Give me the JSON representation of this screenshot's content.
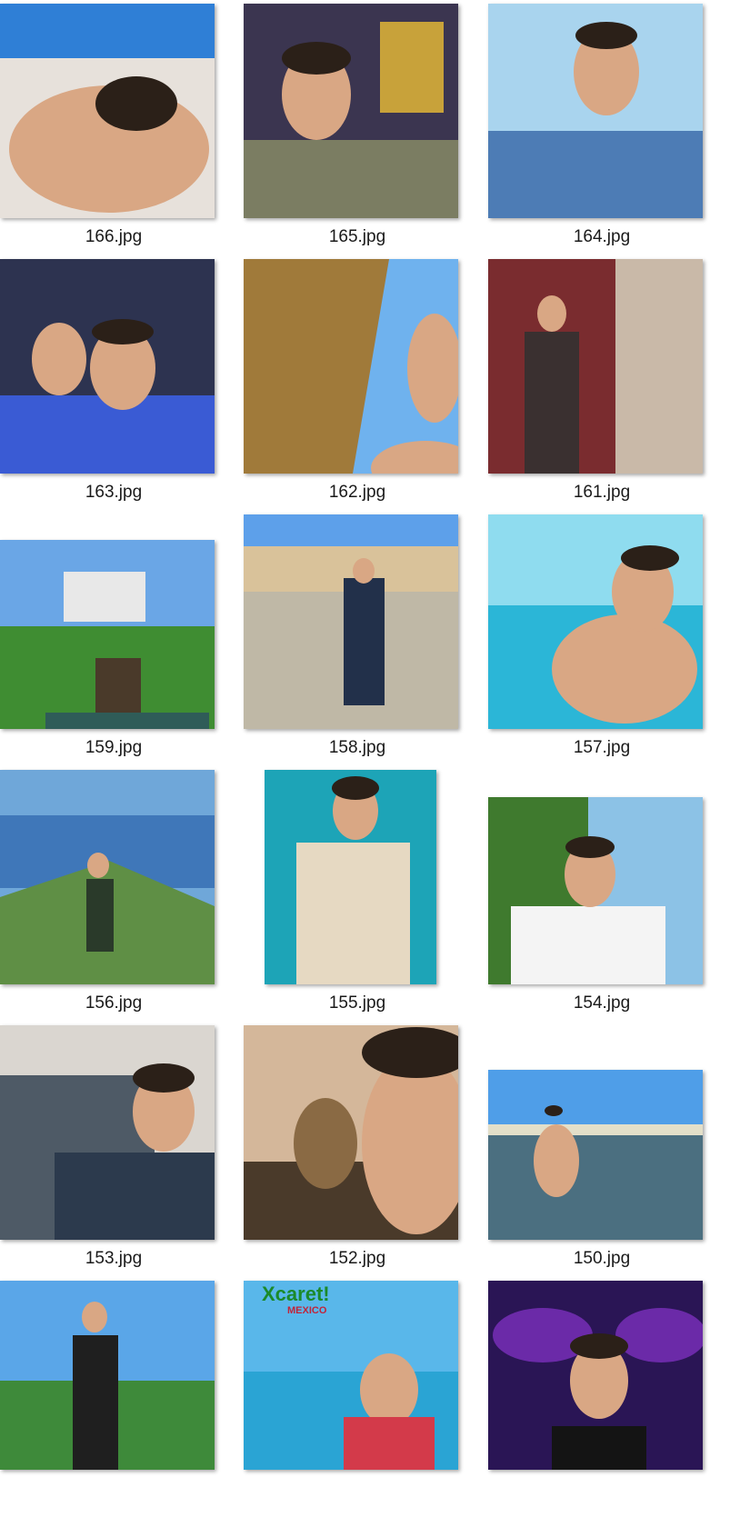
{
  "files": [
    {
      "name": "166.jpg",
      "icon": "photo-thumbnail",
      "sky": "#2f7fd6",
      "ground": "#e7e1db"
    },
    {
      "name": "165.jpg",
      "icon": "photo-thumbnail",
      "sky": "#3b3550",
      "ground": "#7b7d62"
    },
    {
      "name": "164.jpg",
      "icon": "photo-thumbnail",
      "sky": "#a9d4ee",
      "ground": "#4d7cb5"
    },
    {
      "name": "163.jpg",
      "icon": "photo-thumbnail",
      "sky": "#2d3350",
      "ground": "#3a5bd4"
    },
    {
      "name": "162.jpg",
      "icon": "photo-thumbnail",
      "sky": "#6fb2ee",
      "ground": "#a07a3a"
    },
    {
      "name": "161.jpg",
      "icon": "photo-thumbnail",
      "sky": "#7a2c2f",
      "ground": "#c9b9a8"
    },
    {
      "name": "159.jpg",
      "icon": "photo-thumbnail",
      "sky": "#6aa6e6",
      "ground": "#3f8d32"
    },
    {
      "name": "158.jpg",
      "icon": "photo-thumbnail",
      "sky": "#5da0ea",
      "ground": "#bfb8a6"
    },
    {
      "name": "157.jpg",
      "icon": "photo-thumbnail",
      "sky": "#8fdcef",
      "ground": "#2bb6d7"
    },
    {
      "name": "156.jpg",
      "icon": "photo-thumbnail",
      "sky": "#6fa7d9",
      "ground": "#5f8f45"
    },
    {
      "name": "155.jpg",
      "icon": "photo-thumbnail",
      "sky": "#1da4b7",
      "ground": "#e6d9c2"
    },
    {
      "name": "154.jpg",
      "icon": "photo-thumbnail",
      "sky": "#8cc2e6",
      "ground": "#3f7a2e"
    },
    {
      "name": "153.jpg",
      "icon": "photo-thumbnail",
      "sky": "#dad6d0",
      "ground": "#2c3a4d"
    },
    {
      "name": "152.jpg",
      "icon": "photo-thumbnail",
      "sky": "#d4b79a",
      "ground": "#4a3a2a"
    },
    {
      "name": "150.jpg",
      "icon": "photo-thumbnail",
      "sky": "#4f9ee8",
      "ground": "#4b6f80"
    },
    {
      "name": "",
      "icon": "photo-thumbnail",
      "sky": "#5aa6e8",
      "ground": "#3e8a3a"
    },
    {
      "name": "",
      "icon": "photo-thumbnail",
      "sky": "#59b7ea",
      "ground": "#2aa4d4",
      "logo": "Xcaret!",
      "logo_sub": "MEXICO"
    },
    {
      "name": "",
      "icon": "photo-thumbnail",
      "sky": "#2a1555",
      "ground": "#6b2aa8"
    }
  ]
}
